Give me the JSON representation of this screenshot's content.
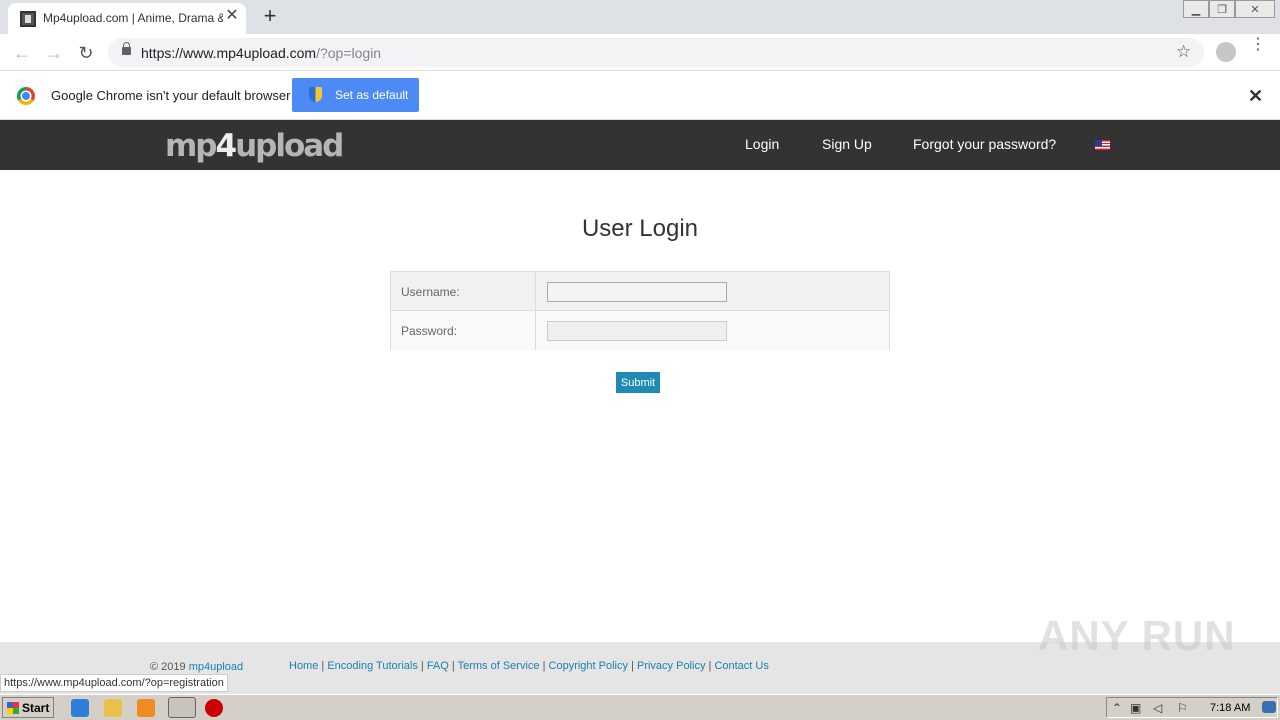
{
  "browser": {
    "tab_title": "Mp4upload.com | Anime, Drama & G",
    "tab_close": "✕",
    "new_tab": "+",
    "url_host": "https://www.mp4upload.com",
    "url_path": "/?op=login",
    "back": "←",
    "forward": "→",
    "reload": "↻",
    "star": "☆",
    "menu": "⋮"
  },
  "infobar": {
    "message": "Google Chrome isn't your default browser",
    "button": "Set as default",
    "close": "✕"
  },
  "site": {
    "logo_a": "mp",
    "logo_b": "4",
    "logo_c": "upload",
    "nav": [
      "Login",
      "Sign Up",
      "Forgot your password?"
    ]
  },
  "login": {
    "title": "User Login",
    "username_label": "Username:",
    "password_label": "Password:",
    "username_value": "",
    "password_value": "",
    "submit": "Submit"
  },
  "footer": {
    "copyright": "© 2019",
    "copyright_link": "mp4upload",
    "links": [
      "Home",
      "Encoding Tutorials",
      "FAQ",
      "Terms of Service",
      "Copyright Policy",
      "Privacy Policy",
      "Contact Us"
    ]
  },
  "status_bar_url": "https://www.mp4upload.com/?op=registration",
  "watermark": "ANY RUN",
  "taskbar": {
    "start": "Start",
    "clock": "7:18 AM"
  },
  "colors": {
    "nav_bg": "#333333",
    "submit_bg": "#1f8bb5",
    "link": "#1a7fb0",
    "infobar_button": "#4c8bf5"
  }
}
